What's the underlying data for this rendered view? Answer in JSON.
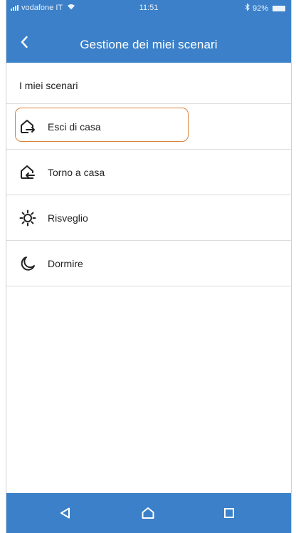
{
  "status_bar": {
    "carrier": "vodafone IT",
    "time": "11:51",
    "battery": "92%",
    "icons": [
      "signal-icon",
      "wifi-icon",
      "bluetooth-icon",
      "battery-icon"
    ]
  },
  "app_bar": {
    "title": "Gestione dei miei scenari",
    "back_icon": "chevron-left-icon"
  },
  "section": {
    "title": "I miei scenari"
  },
  "scenarios": [
    {
      "label": "Esci di casa",
      "icon": "house-exit-icon",
      "selected": true
    },
    {
      "label": "Torno a casa",
      "icon": "house-enter-icon",
      "selected": false
    },
    {
      "label": "Risveglio",
      "icon": "sun-icon",
      "selected": false
    },
    {
      "label": "Dormire",
      "icon": "moon-icon",
      "selected": false
    }
  ],
  "nav_bar": {
    "icons": [
      "back-triangle-icon",
      "home-icon",
      "recents-square-icon"
    ]
  },
  "colors": {
    "primary": "#3b80c9",
    "highlight": "#d9823a",
    "divider": "#dcdcdc",
    "text": "#222222"
  }
}
